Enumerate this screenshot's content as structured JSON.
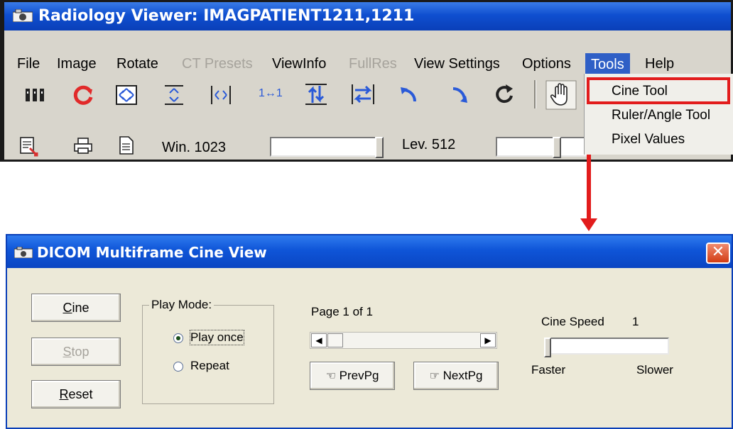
{
  "top_window": {
    "title": "Radiology Viewer: IMAGPATIENT1211,1211",
    "menu": [
      {
        "label": "File",
        "enabled": true
      },
      {
        "label": "Image",
        "enabled": true
      },
      {
        "label": "Rotate",
        "enabled": true
      },
      {
        "label": "CT Presets",
        "enabled": false
      },
      {
        "label": "ViewInfo",
        "enabled": true
      },
      {
        "label": "FullRes",
        "enabled": false
      },
      {
        "label": "View Settings",
        "enabled": true
      },
      {
        "label": "Options",
        "enabled": true
      },
      {
        "label": "Tools",
        "enabled": true,
        "active": true
      },
      {
        "label": "Help",
        "enabled": true
      }
    ],
    "toolbar_icons": [
      "stack-icon",
      "refresh-icon",
      "fit-window-icon",
      "vertical-fit-icon",
      "horizontal-fit-icon",
      "actual-size-icon",
      "flip-vertical-icon",
      "flip-horizontal-icon",
      "rotate-left-icon",
      "rotate-right-icon",
      "rotate-clockwise-icon",
      "pan-hand-icon"
    ],
    "toolbar_one_to_one": "1↔1",
    "window_label": "Win. 1023",
    "level_label": "Lev. 512",
    "tools_menu": [
      "Cine Tool",
      "Ruler/Angle Tool",
      "Pixel Values"
    ]
  },
  "dialog": {
    "title": "DICOM Multiframe Cine View",
    "close_label": "✕",
    "buttons": {
      "cine": "Cine",
      "stop": "Stop",
      "reset": "Reset"
    },
    "play_mode": {
      "legend": "Play Mode:",
      "options": [
        "Play once",
        "Repeat"
      ],
      "selected": "Play once"
    },
    "page_label": "Page 1 of 1",
    "prev_label": "PrevPg",
    "next_label": "NextPg",
    "cine_speed_label": "Cine Speed",
    "cine_speed_value": "1",
    "faster_label": "Faster",
    "slower_label": "Slower"
  },
  "colors": {
    "highlight": "#e21c1c",
    "titlebar": "#0f4fd0",
    "menu_active": "#2f5fc6"
  }
}
